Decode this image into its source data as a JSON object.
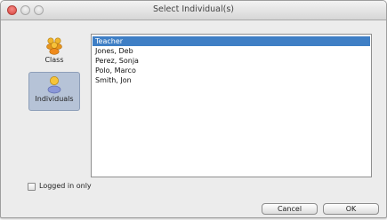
{
  "window": {
    "title": "Select Individual(s)"
  },
  "sidebar": {
    "items": [
      {
        "label": "Class",
        "icon": "group-people-icon",
        "selected": false
      },
      {
        "label": "Individuals",
        "icon": "person-icon",
        "selected": true
      }
    ]
  },
  "list": {
    "items": [
      "Teacher",
      "Jones, Deb",
      "Perez, Sonja",
      "Polo, Marco",
      "Smith, Jon"
    ],
    "selected_index": 0
  },
  "options": {
    "logged_in_only_label": "Logged in only",
    "logged_in_only_checked": false
  },
  "buttons": {
    "cancel": "Cancel",
    "ok": "OK"
  },
  "colors": {
    "selection": "#3f7fc5",
    "sidebar_selected": "#b6c3d7"
  }
}
